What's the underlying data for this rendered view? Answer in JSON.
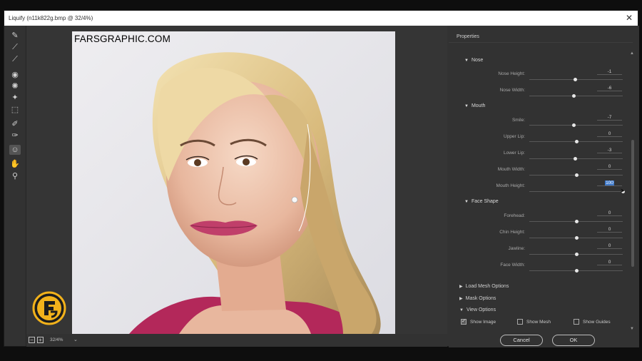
{
  "window": {
    "title": "Liquify (n11k822g.bmp @ 32/4%)",
    "close_symbol": "✕"
  },
  "canvas": {
    "watermark": "FARSGRAPHIC.COM"
  },
  "status": {
    "zoom_out": "−",
    "zoom_in": "+",
    "zoom": "32/4%",
    "dropdown": "⌄"
  },
  "tools": [
    {
      "name": "forward-warp-tool-icon",
      "glyph": "✎"
    },
    {
      "name": "reconstruct-tool-icon",
      "glyph": "⟋"
    },
    {
      "name": "smooth-tool-icon",
      "glyph": "⟋"
    },
    {
      "name": "twirl-tool-icon",
      "glyph": "◉"
    },
    {
      "name": "pucker-tool-icon",
      "glyph": "✺"
    },
    {
      "name": "bloat-tool-icon",
      "glyph": "✦"
    },
    {
      "name": "push-left-tool-icon",
      "glyph": "⬚"
    },
    {
      "name": "freeze-mask-tool-icon",
      "glyph": "✐"
    },
    {
      "name": "thaw-mask-tool-icon",
      "glyph": "✑"
    },
    {
      "name": "face-tool-icon",
      "glyph": "☺"
    },
    {
      "name": "hand-tool-icon",
      "glyph": "✋"
    },
    {
      "name": "zoom-tool-icon",
      "glyph": "⚲"
    }
  ],
  "panel": {
    "title": "Properties",
    "sections": [
      {
        "name": "Nose",
        "sliders": [
          {
            "label": "Nose Height:",
            "value": "-1",
            "position": 0.49
          },
          {
            "label": "Nose Width:",
            "value": "-6",
            "position": 0.47
          }
        ]
      },
      {
        "name": "Mouth",
        "sliders": [
          {
            "label": "Smile:",
            "value": "-7",
            "position": 0.47
          },
          {
            "label": "Upper Lip:",
            "value": "0",
            "position": 0.5
          },
          {
            "label": "Lower Lip:",
            "value": "-3",
            "position": 0.49
          },
          {
            "label": "Mouth Width:",
            "value": "0",
            "position": 0.5
          },
          {
            "label": "Mouth Height:",
            "value": "100",
            "position": 1.0,
            "highlighted": true
          }
        ]
      },
      {
        "name": "Face Shape",
        "sliders": [
          {
            "label": "Forehead:",
            "value": "0",
            "position": 0.5
          },
          {
            "label": "Chin Height:",
            "value": "0",
            "position": 0.5
          },
          {
            "label": "Jawline:",
            "value": "0",
            "position": 0.5
          },
          {
            "label": "Face Width:",
            "value": "0",
            "position": 0.5
          }
        ]
      }
    ],
    "options": {
      "load_mesh": "Load Mesh Options",
      "mask": "Mask Options",
      "view": "View Options"
    },
    "view_checks": [
      {
        "label": "Show Image",
        "checked": true
      },
      {
        "label": "Show Mesh",
        "checked": false
      },
      {
        "label": "Show Guides",
        "checked": false
      }
    ],
    "cancel_label": "Cancel",
    "ok_label": "OK"
  }
}
